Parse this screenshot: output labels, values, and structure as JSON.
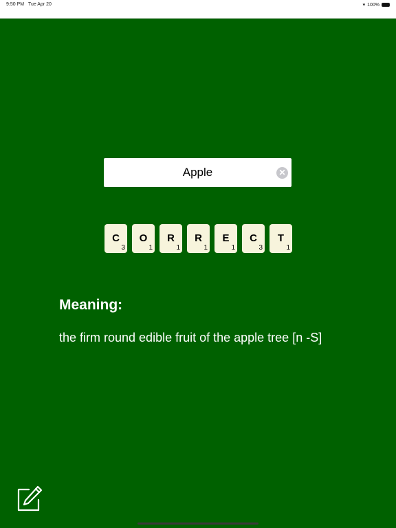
{
  "status_bar": {
    "time": "9:50 PM",
    "date": "Tue Apr 20",
    "battery": "100%"
  },
  "search": {
    "value": "Apple"
  },
  "result_tiles": [
    {
      "letter": "C",
      "value": "3"
    },
    {
      "letter": "O",
      "value": "1"
    },
    {
      "letter": "R",
      "value": "1"
    },
    {
      "letter": "R",
      "value": "1"
    },
    {
      "letter": "E",
      "value": "1"
    },
    {
      "letter": "C",
      "value": "3"
    },
    {
      "letter": "T",
      "value": "1"
    }
  ],
  "meaning": {
    "heading": "Meaning:",
    "text": "the firm round edible fruit of the apple tree [n -S]"
  },
  "colors": {
    "background": "#006100",
    "tile": "#f7f4dc"
  },
  "icons": {
    "clear": "clear-circle-icon",
    "edit": "square-pencil-icon"
  }
}
